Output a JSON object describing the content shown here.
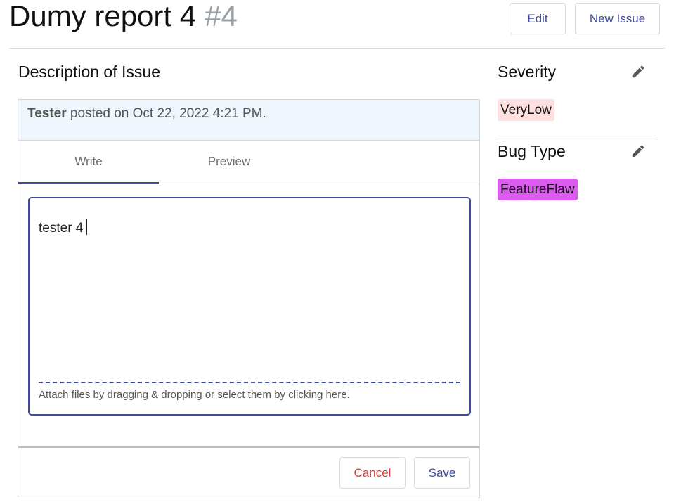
{
  "header": {
    "title": "Dumy report 4",
    "number": "#4",
    "edit_label": "Edit",
    "new_issue_label": "New Issue"
  },
  "description": {
    "section_title": "Description of Issue",
    "author": "Tester",
    "posted_text": "posted on Oct 22, 2022 4:21 PM.",
    "tabs": [
      {
        "label": "Write",
        "active": true
      },
      {
        "label": "Preview",
        "active": false
      }
    ],
    "editor_value": "tester 4",
    "attach_hint": "Attach files by dragging & dropping or select them by clicking here.",
    "cancel_label": "Cancel",
    "save_label": "Save"
  },
  "sidebar": {
    "severity": {
      "title": "Severity",
      "value": "VeryLow",
      "color": "#ffe0e0",
      "edit_icon": "pencil-icon"
    },
    "bug_type": {
      "title": "Bug Type",
      "value": "FeatureFlaw",
      "color": "#dd5cf0",
      "edit_icon": "pencil-icon"
    }
  },
  "colors": {
    "accent": "#3f4a9e",
    "danger": "#e53935"
  }
}
